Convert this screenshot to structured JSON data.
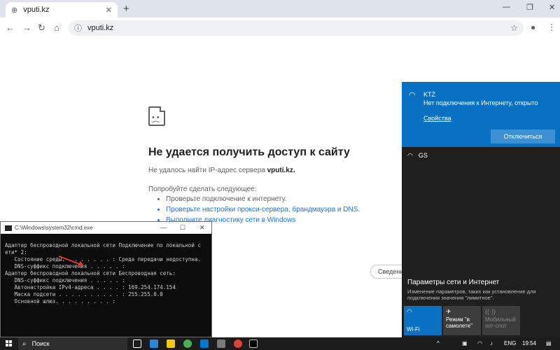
{
  "browser": {
    "tab_title": "vputi.kz",
    "url": "vputi.kz"
  },
  "error_page": {
    "title": "Не удается получить доступ к сайту",
    "subtitle_prefix": "Не удалось найти IP-адрес сервера ",
    "subtitle_host": "vputi.kz.",
    "try_label": "Попробуйте сделать следующее:",
    "suggestions": [
      "Проверьте подключение к интернету.",
      "Проверьте настройки прокси-сервера, брандмауэра и DNS.",
      "Выполните диагностику сети в Windows"
    ],
    "details_button": "Сведения"
  },
  "cmd": {
    "title": "C:\\Windows\\system32\\cmd.exe",
    "lines": [
      "Адаптер беспроводной локальной сети Подключение по локальной с",
      "ети* 2:",
      "",
      "   Состояние среды. . . . . . . . : Среда передачи недоступна.",
      "",
      "   DNS-суффикс подключения . . . . . :",
      "",
      "Адаптер беспроводной локальной сети Беспроводная сеть:",
      "",
      "   DNS-суффикс подключения . . . . . :",
      "   Автонастройка IPv4-адреса . . . . : 169.254.174.154",
      "   Маска подсети . . . . . . . . . . : 255.255.0.0",
      "   Основной шлюз. . . . . . . . . :"
    ]
  },
  "network_flyout": {
    "connected_name": "KTZ",
    "connected_status": "Нет подключения к Интернету, открыто",
    "properties_link": "Свойства",
    "disconnect_button": "Отключиться",
    "other_network": "GS",
    "settings_link": "Параметры сети и Интернет",
    "settings_desc": "Изменение параметров, таких как установление для подключения значения \"лимитное\".",
    "tiles": [
      {
        "label": "Wi-Fi"
      },
      {
        "label": "Режим \"в самолете\""
      },
      {
        "label": "Мобильный хот-спот"
      }
    ]
  },
  "taskbar": {
    "search_label": "Поиск",
    "language": "ENG",
    "time": "19:54"
  },
  "colors": {
    "accent": "#0a70c2",
    "link": "#1a73e8",
    "taskbar": "#1c1c1c"
  }
}
